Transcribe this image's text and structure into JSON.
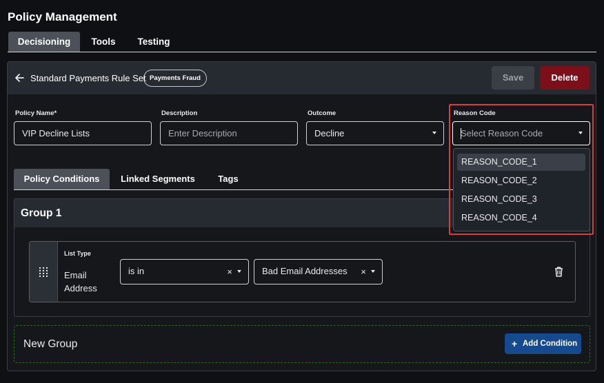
{
  "header": {
    "title": "Policy Management"
  },
  "top_tabs": [
    {
      "label": "Decisioning",
      "active": true
    },
    {
      "label": "Tools",
      "active": false
    },
    {
      "label": "Testing",
      "active": false
    }
  ],
  "ruleset": {
    "back_icon": "arrow-left-icon",
    "title": "Standard Payments Rule Set",
    "badge": "Payments Fraud",
    "save_label": "Save",
    "delete_label": "Delete"
  },
  "form": {
    "policy_name": {
      "label": "Policy Name*",
      "value": "VIP Decline Lists"
    },
    "description": {
      "label": "Description",
      "placeholder": "Enter Description"
    },
    "outcome": {
      "label": "Outcome",
      "value": "Decline"
    },
    "reason_code": {
      "label": "Reason Code",
      "placeholder": "Select Reason Code"
    }
  },
  "reason_code_options": [
    "REASON_CODE_1",
    "REASON_CODE_2",
    "REASON_CODE_3",
    "REASON_CODE_4"
  ],
  "inner_tabs": [
    {
      "label": "Policy Conditions",
      "active": true
    },
    {
      "label": "Linked Segments",
      "active": false
    },
    {
      "label": "Tags",
      "active": false
    }
  ],
  "group": {
    "title": "Group 1",
    "condition": {
      "type_label": "List Type",
      "field_line1": "Email",
      "field_line2": "Address",
      "operator": "is in",
      "list": "Bad Email Addresses",
      "clear_symbol": "×"
    }
  },
  "new_group": {
    "title": "New Group",
    "add_label": "Add Condition",
    "add_icon": "+"
  },
  "colors": {
    "accent_blue": "#154a8f",
    "delete_red": "#7d0f1a",
    "highlight_red": "#e03a3a",
    "dashed_green": "#2f6b25"
  }
}
